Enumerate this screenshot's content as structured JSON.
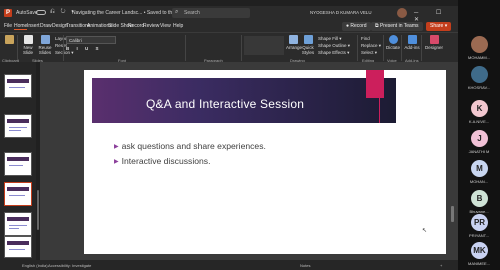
{
  "titlebar": {
    "logo": "P",
    "autosave": "AutoSave",
    "quick_access": "⎌ ↻ ▾",
    "document": "Navigating the Career Landsc... • Saved to this PC ▾",
    "search_placeholder": "Search",
    "user_name": "NYOGESHA D KUMARA VELU",
    "window_controls": "─ ☐ ✕"
  },
  "menu": {
    "tabs": [
      "File",
      "Home",
      "Insert",
      "Draw",
      "Design",
      "Transitions",
      "Animations",
      "Slide Show",
      "Record",
      "Review",
      "View",
      "Help"
    ],
    "active_tab": "Home",
    "record": "● Record",
    "present": "⧉ Present in Teams",
    "share": "Share ▾"
  },
  "ribbon": {
    "new_slide": "New Slide",
    "reuse_slides": "Reuse Slides",
    "layout": "Layout ▾",
    "reset": "Reset",
    "section": "Section ▾",
    "font_name": "Calibri",
    "arrange": "Arrange",
    "quick_styles": "Quick Styles",
    "shape_fill": "Shape Fill ▾",
    "shape_outline": "Shape Outline ▾",
    "shape_effects": "Shape Effects ▾",
    "find": "Find",
    "replace": "Replace ▾",
    "select": "Select ▾",
    "dictate": "Dictate",
    "add_ins": "Add-ins",
    "designer": "Designer",
    "groups": [
      "Clipboard",
      "Slides",
      "Font",
      "Paragraph",
      "Drawing",
      "Editing",
      "Voice",
      "Add-ins"
    ]
  },
  "thumbnails": {
    "numbers": [
      "",
      "",
      "",
      "",
      "",
      "",
      "",
      ""
    ]
  },
  "slide": {
    "title": "Q&A and Interactive Session",
    "bullets": [
      "ask questions and share experiences.",
      "Interactive discussions."
    ]
  },
  "status": {
    "language": "English (India)",
    "accessibility": "Accessibility: Investigate",
    "notes": "Notes",
    "zoom": "+"
  },
  "participants": [
    {
      "initials": "",
      "name": "MOHAMM...",
      "color": "#9b6a52"
    },
    {
      "initials": "",
      "name": "KHOSRAV...",
      "color": "#3f6b8a"
    },
    {
      "initials": "K",
      "name": "K.A.NIVE...",
      "color": "#f2c7cf"
    },
    {
      "initials": "J",
      "name": "JANATHI M",
      "color": "#f1c1d6"
    },
    {
      "initials": "M",
      "name": "MOHAN...",
      "color": "#c8d6f0"
    },
    {
      "initials": "B",
      "name": "Bhuvane...",
      "color": "#cfe3d6"
    },
    {
      "initials": "PR",
      "name": "PRIYANT...",
      "color": "#c9d2f2"
    },
    {
      "initials": "MK",
      "name": "MANIMEE...",
      "color": "#c9d2f2"
    }
  ]
}
